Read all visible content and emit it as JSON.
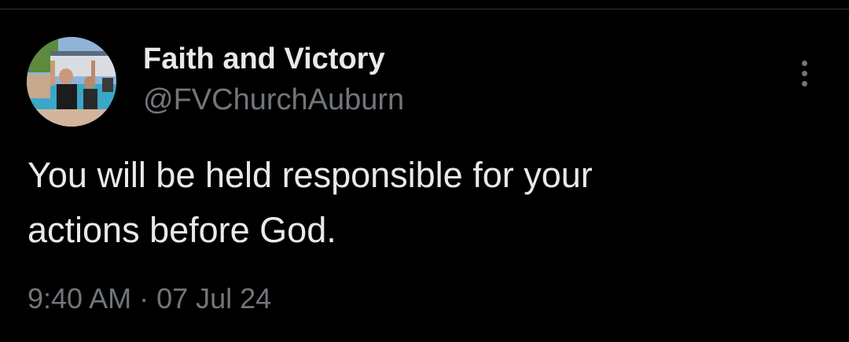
{
  "tweet": {
    "author": {
      "display_name": "Faith and Victory",
      "handle": "@FVChurchAuburn",
      "avatar": "profile-photo"
    },
    "text": "You will be held responsible for your\nactions before God.",
    "timestamp": "9:40 AM · 07 Jul 24",
    "more_icon": "more-vertical-icon"
  },
  "colors": {
    "background": "#000000",
    "primary_text": "#e7e9ea",
    "secondary_text": "#71767b",
    "divider": "#2f3336"
  }
}
